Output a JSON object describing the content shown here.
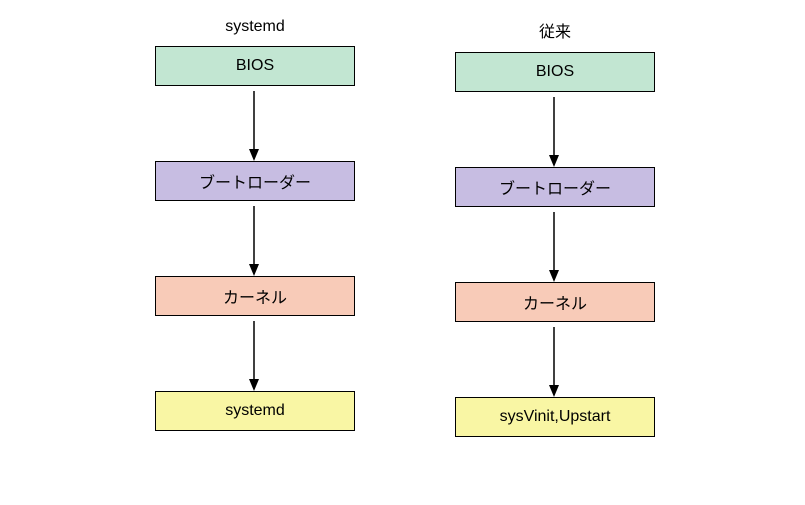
{
  "columns": {
    "left": {
      "title": "systemd",
      "boxes": [
        "BIOS",
        "ブートローダー",
        "カーネル",
        "systemd"
      ]
    },
    "right": {
      "title": "従来",
      "boxes": [
        "BIOS",
        "ブートローダー",
        "カーネル",
        "sysVinit,Upstart"
      ]
    }
  },
  "colors": {
    "green": "#c2e6d2",
    "purple": "#c7bde2",
    "peach": "#f8cbb8",
    "yellow": "#f9f6a4"
  }
}
